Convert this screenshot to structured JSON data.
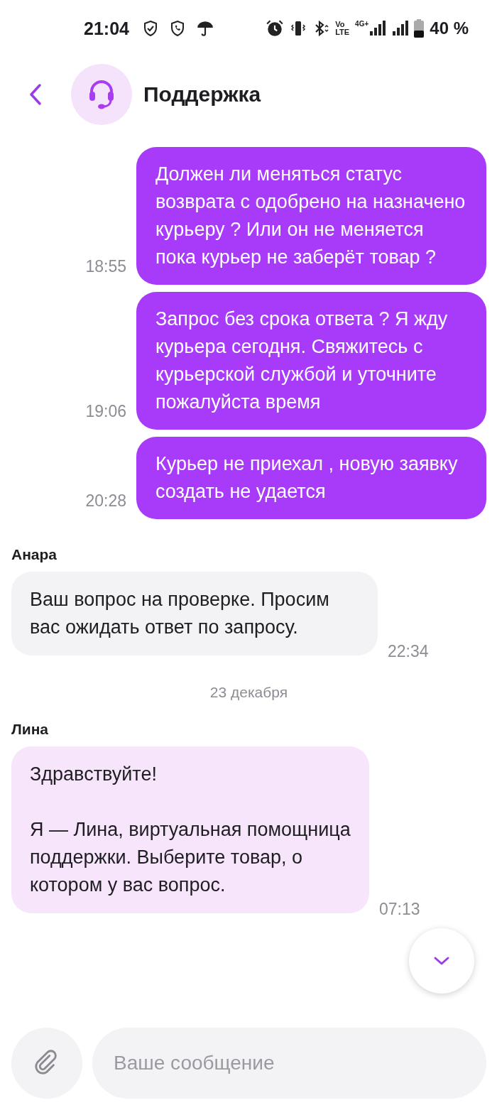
{
  "status_bar": {
    "time": "21:04",
    "volte": [
      "Vo",
      "LTE"
    ],
    "network": "4G+",
    "battery": "40 %"
  },
  "header": {
    "title": "Поддержка"
  },
  "messages": [
    {
      "kind": "outgoing",
      "text": "Должен ли меняться статус возврата с одобрено на назначено курьеру ? Или он не меняется пока курьер не заберёт товар ?",
      "time": "18:55"
    },
    {
      "kind": "outgoing",
      "text": "Запрос без срока ответа ? Я жду курьера сегодня. Свяжитесь с курьерской службой и уточните пожалуйста время",
      "time": "19:06"
    },
    {
      "kind": "outgoing",
      "text": "Курьер не приехал , новую заявку создать не удается",
      "time": "20:28"
    },
    {
      "kind": "incoming",
      "author": "Анара",
      "text": "Ваш вопрос на проверке. Просим вас ожидать ответ по запросу.",
      "time": "22:34"
    },
    {
      "kind": "date",
      "text": "23 декабря"
    },
    {
      "kind": "bot",
      "author": "Лина",
      "text": "Здравствуйте!\n\nЯ — Лина, виртуальная помощница поддержки. Выберите товар, о котором у вас вопрос.",
      "time": "07:13"
    }
  ],
  "composer": {
    "placeholder": "Ваше сообщение"
  }
}
